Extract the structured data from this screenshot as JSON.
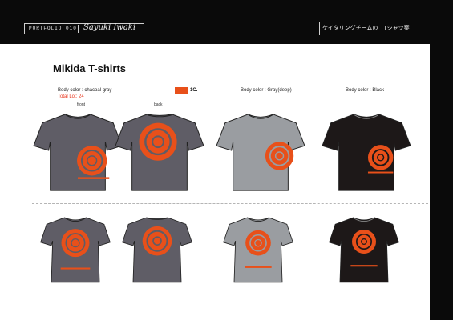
{
  "header": {
    "portfolio": "PORTFOLIO 010",
    "signature": "Sayuki Iwaki",
    "title": "ケイタリングチームの　Tシャツ案"
  },
  "section_title": "Mikida T-shirts",
  "variants": [
    {
      "body_color": "Body color : chacoal gray",
      "total_lot": "Total Lot: 24"
    },
    {
      "body_color": "Body color : Gray(deep)"
    },
    {
      "body_color": "Body color : Black"
    }
  ],
  "print_colors": {
    "swatch_label": "1C."
  },
  "views": {
    "front": "front",
    "back": "back"
  },
  "colors": {
    "charcoal": "#5f5d66",
    "gray": "#9a9da1",
    "black": "#1d1818",
    "print": "#e8501a"
  }
}
